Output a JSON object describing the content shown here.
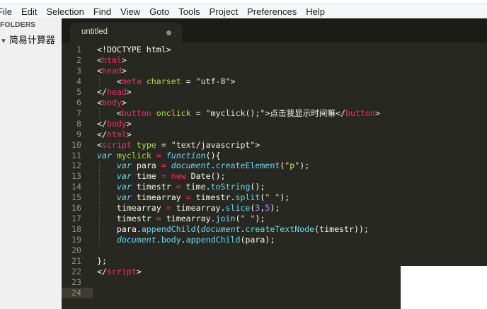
{
  "window": {
    "title_fragment": "(. . . . . . / . . .)"
  },
  "menu": [
    "File",
    "Edit",
    "Selection",
    "Find",
    "View",
    "Goto",
    "Tools",
    "Project",
    "Preferences",
    "Help"
  ],
  "sidebar": {
    "header": "FOLDERS",
    "folder": "简易计算器"
  },
  "tab": {
    "title": "untitled"
  },
  "code": [
    [
      [
        "p",
        "<!DOCTYPE html>"
      ]
    ],
    [
      [
        "p",
        "<"
      ],
      [
        "t",
        "html"
      ],
      [
        "p",
        ">"
      ]
    ],
    [
      [
        "p",
        "<"
      ],
      [
        "t",
        "head"
      ],
      [
        "p",
        ">"
      ]
    ],
    [
      [
        "p",
        "    <"
      ],
      [
        "t",
        "meta"
      ],
      [
        "p",
        " "
      ],
      [
        "a",
        "charset"
      ],
      [
        "p",
        " = "
      ],
      [
        "hs",
        "\"utf-8\""
      ],
      [
        "p",
        ">"
      ]
    ],
    [
      [
        "p",
        "</"
      ],
      [
        "t",
        "head"
      ],
      [
        "p",
        ">"
      ]
    ],
    [
      [
        "p",
        "<"
      ],
      [
        "t",
        "body"
      ],
      [
        "p",
        ">"
      ]
    ],
    [
      [
        "p",
        "    <"
      ],
      [
        "t",
        "button"
      ],
      [
        "p",
        " "
      ],
      [
        "a",
        "onclick"
      ],
      [
        "p",
        " = "
      ],
      [
        "hs",
        "\"myclick();\""
      ],
      [
        "p",
        ">点击我显示时间嘛</"
      ],
      [
        "t",
        "button"
      ],
      [
        "p",
        ">"
      ]
    ],
    [
      [
        "p",
        "</"
      ],
      [
        "t",
        "body"
      ],
      [
        "p",
        ">"
      ]
    ],
    [
      [
        "p",
        "</"
      ],
      [
        "t",
        "html"
      ],
      [
        "p",
        ">"
      ]
    ],
    [
      [
        "p",
        "<"
      ],
      [
        "t",
        "script"
      ],
      [
        "p",
        " "
      ],
      [
        "a",
        "type"
      ],
      [
        "p",
        " = "
      ],
      [
        "hs",
        "\"text/javascript\""
      ],
      [
        "p",
        ">"
      ]
    ],
    [
      [
        "k",
        "var"
      ],
      [
        "p",
        " "
      ],
      [
        "a",
        "myclick"
      ],
      [
        "p",
        " "
      ],
      [
        "o",
        "="
      ],
      [
        "p",
        " "
      ],
      [
        "i",
        "function"
      ],
      [
        "p",
        "(){"
      ]
    ],
    [
      [
        "p",
        "    "
      ],
      [
        "k",
        "var"
      ],
      [
        "p",
        " para "
      ],
      [
        "o",
        "="
      ],
      [
        "p",
        " "
      ],
      [
        "i",
        "document"
      ],
      [
        "p",
        "."
      ],
      [
        "f",
        "createElement"
      ],
      [
        "p",
        "("
      ],
      [
        "s",
        "\"p\""
      ],
      [
        "p",
        ");"
      ]
    ],
    [
      [
        "p",
        "    "
      ],
      [
        "k",
        "var"
      ],
      [
        "p",
        " time "
      ],
      [
        "o",
        "="
      ],
      [
        "p",
        " "
      ],
      [
        "o",
        "new"
      ],
      [
        "p",
        " Date();"
      ]
    ],
    [
      [
        "p",
        "    "
      ],
      [
        "k",
        "var"
      ],
      [
        "p",
        " timestr "
      ],
      [
        "o",
        "="
      ],
      [
        "p",
        " time."
      ],
      [
        "f",
        "toString"
      ],
      [
        "p",
        "();"
      ]
    ],
    [
      [
        "p",
        "    "
      ],
      [
        "k",
        "var"
      ],
      [
        "p",
        " timearray "
      ],
      [
        "o",
        "="
      ],
      [
        "p",
        " timestr."
      ],
      [
        "f",
        "split"
      ],
      [
        "p",
        "("
      ],
      [
        "s",
        "\" \""
      ],
      [
        "p",
        ");"
      ]
    ],
    [
      [
        "p",
        "    timearray "
      ],
      [
        "o",
        "="
      ],
      [
        "p",
        " timearray."
      ],
      [
        "f",
        "slice"
      ],
      [
        "p",
        "("
      ],
      [
        "n",
        "3"
      ],
      [
        "p",
        ","
      ],
      [
        "n",
        "5"
      ],
      [
        "p",
        ");"
      ]
    ],
    [
      [
        "p",
        "    timestr "
      ],
      [
        "o",
        "="
      ],
      [
        "p",
        " timearray."
      ],
      [
        "f",
        "join"
      ],
      [
        "p",
        "("
      ],
      [
        "s",
        "\" \""
      ],
      [
        "p",
        ");"
      ]
    ],
    [
      [
        "p",
        "    para."
      ],
      [
        "f",
        "appendChild"
      ],
      [
        "p",
        "("
      ],
      [
        "i",
        "document"
      ],
      [
        "p",
        "."
      ],
      [
        "f",
        "createTextNode"
      ],
      [
        "p",
        "(timestr));"
      ]
    ],
    [
      [
        "p",
        "    "
      ],
      [
        "i",
        "document"
      ],
      [
        "p",
        "."
      ],
      [
        "f",
        "body"
      ],
      [
        "p",
        "."
      ],
      [
        "f",
        "appendChild"
      ],
      [
        "p",
        "(para);"
      ]
    ],
    [],
    [
      [
        "p",
        "};"
      ]
    ],
    [
      [
        "p",
        "</"
      ],
      [
        "t",
        "script"
      ],
      [
        "p",
        ">"
      ]
    ],
    [],
    []
  ],
  "current_line": 24
}
